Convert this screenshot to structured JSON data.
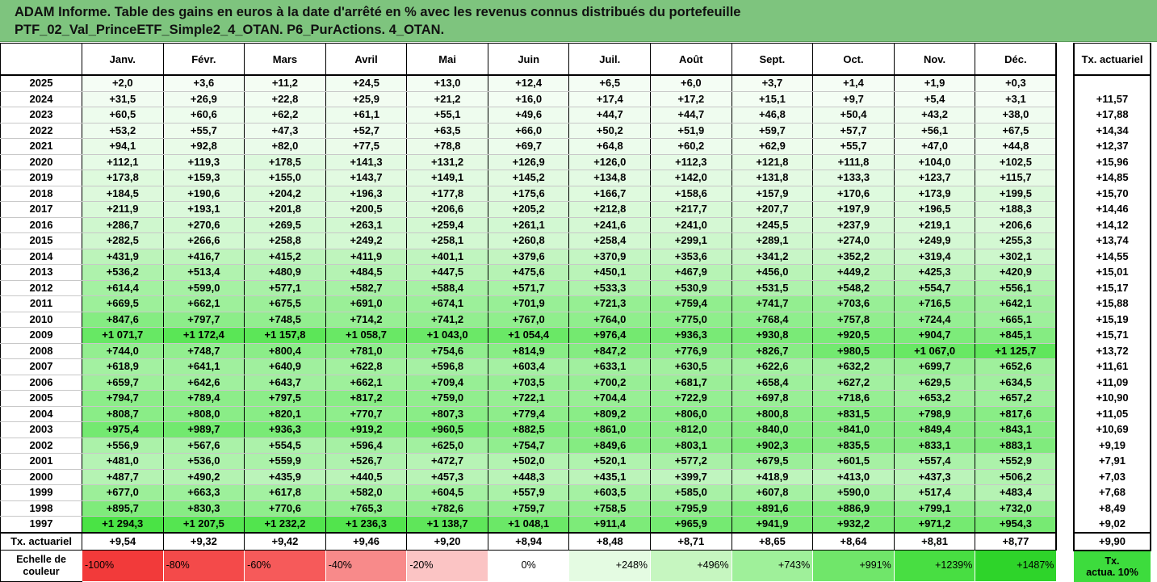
{
  "header": {
    "line1": "ADAM Informe. Table des gains en euros à la date d'arrêté en % avec les revenus connus distribués du portefeuille",
    "line2": "PTF_02_Val_PrinceETF_Simple2_4_OTAN. P6_PurActions. 4_OTAN."
  },
  "months": [
    "Janv.",
    "Févr.",
    "Mars",
    "Avril",
    "Mai",
    "Juin",
    "Juil.",
    "Août",
    "Sept.",
    "Oct.",
    "Nov.",
    "Déc."
  ],
  "side_header": "Tx. actuariel",
  "rows": [
    {
      "year": "2025",
      "values": [
        "+2,0",
        "+3,6",
        "+11,2",
        "+24,5",
        "+13,0",
        "+12,4",
        "+6,5",
        "+6,0",
        "+3,7",
        "+1,4",
        "+1,9",
        "+0,3"
      ],
      "tx": ""
    },
    {
      "year": "2024",
      "values": [
        "+31,5",
        "+26,9",
        "+22,8",
        "+25,9",
        "+21,2",
        "+16,0",
        "+17,4",
        "+17,2",
        "+15,1",
        "+9,7",
        "+5,4",
        "+3,1"
      ],
      "tx": "+11,57"
    },
    {
      "year": "2023",
      "values": [
        "+60,5",
        "+60,6",
        "+62,2",
        "+61,1",
        "+55,1",
        "+49,6",
        "+44,7",
        "+44,7",
        "+46,8",
        "+50,4",
        "+43,2",
        "+38,0"
      ],
      "tx": "+17,88"
    },
    {
      "year": "2022",
      "values": [
        "+53,2",
        "+55,7",
        "+47,3",
        "+52,7",
        "+63,5",
        "+66,0",
        "+50,2",
        "+51,9",
        "+59,7",
        "+57,7",
        "+56,1",
        "+67,5"
      ],
      "tx": "+14,34"
    },
    {
      "year": "2021",
      "values": [
        "+94,1",
        "+92,8",
        "+82,0",
        "+77,5",
        "+78,8",
        "+69,7",
        "+64,8",
        "+60,2",
        "+62,9",
        "+55,7",
        "+47,0",
        "+44,8"
      ],
      "tx": "+12,37"
    },
    {
      "year": "2020",
      "values": [
        "+112,1",
        "+119,3",
        "+178,5",
        "+141,3",
        "+131,2",
        "+126,9",
        "+126,0",
        "+112,3",
        "+121,8",
        "+111,8",
        "+104,0",
        "+102,5"
      ],
      "tx": "+15,96"
    },
    {
      "year": "2019",
      "values": [
        "+173,8",
        "+159,3",
        "+155,0",
        "+143,7",
        "+149,1",
        "+145,2",
        "+134,8",
        "+142,0",
        "+131,8",
        "+133,3",
        "+123,7",
        "+115,7"
      ],
      "tx": "+14,85"
    },
    {
      "year": "2018",
      "values": [
        "+184,5",
        "+190,6",
        "+204,2",
        "+196,3",
        "+177,8",
        "+175,6",
        "+166,7",
        "+158,6",
        "+157,9",
        "+170,6",
        "+173,9",
        "+199,5"
      ],
      "tx": "+15,70"
    },
    {
      "year": "2017",
      "values": [
        "+211,9",
        "+193,1",
        "+201,8",
        "+200,5",
        "+206,6",
        "+205,2",
        "+212,8",
        "+217,7",
        "+207,7",
        "+197,9",
        "+196,5",
        "+188,3"
      ],
      "tx": "+14,46"
    },
    {
      "year": "2016",
      "values": [
        "+286,7",
        "+270,6",
        "+269,5",
        "+263,1",
        "+259,4",
        "+261,1",
        "+241,6",
        "+241,0",
        "+245,5",
        "+237,9",
        "+219,1",
        "+206,6"
      ],
      "tx": "+14,12"
    },
    {
      "year": "2015",
      "values": [
        "+282,5",
        "+266,6",
        "+258,8",
        "+249,2",
        "+258,1",
        "+260,8",
        "+258,4",
        "+299,1",
        "+289,1",
        "+274,0",
        "+249,9",
        "+255,3"
      ],
      "tx": "+13,74"
    },
    {
      "year": "2014",
      "values": [
        "+431,9",
        "+416,7",
        "+415,2",
        "+411,9",
        "+401,1",
        "+379,6",
        "+370,9",
        "+353,6",
        "+341,2",
        "+352,2",
        "+319,4",
        "+302,1"
      ],
      "tx": "+14,55"
    },
    {
      "year": "2013",
      "values": [
        "+536,2",
        "+513,4",
        "+480,9",
        "+484,5",
        "+447,5",
        "+475,6",
        "+450,1",
        "+467,9",
        "+456,0",
        "+449,2",
        "+425,3",
        "+420,9"
      ],
      "tx": "+15,01"
    },
    {
      "year": "2012",
      "values": [
        "+614,4",
        "+599,0",
        "+577,1",
        "+582,7",
        "+588,4",
        "+571,7",
        "+533,3",
        "+530,9",
        "+531,5",
        "+548,2",
        "+554,7",
        "+556,1"
      ],
      "tx": "+15,17"
    },
    {
      "year": "2011",
      "values": [
        "+669,5",
        "+662,1",
        "+675,5",
        "+691,0",
        "+674,1",
        "+701,9",
        "+721,3",
        "+759,4",
        "+741,7",
        "+703,6",
        "+716,5",
        "+642,1"
      ],
      "tx": "+15,88"
    },
    {
      "year": "2010",
      "values": [
        "+847,6",
        "+797,7",
        "+748,5",
        "+714,2",
        "+741,2",
        "+767,0",
        "+764,0",
        "+775,0",
        "+768,4",
        "+757,8",
        "+724,4",
        "+665,1"
      ],
      "tx": "+15,19"
    },
    {
      "year": "2009",
      "values": [
        "+1 071,7",
        "+1 172,4",
        "+1 157,8",
        "+1 058,7",
        "+1 043,0",
        "+1 054,4",
        "+976,4",
        "+936,3",
        "+930,8",
        "+920,5",
        "+904,7",
        "+845,1"
      ],
      "tx": "+15,71"
    },
    {
      "year": "2008",
      "values": [
        "+744,0",
        "+748,7",
        "+800,4",
        "+781,0",
        "+754,6",
        "+814,9",
        "+847,2",
        "+776,9",
        "+826,7",
        "+980,5",
        "+1 067,0",
        "+1 125,7"
      ],
      "tx": "+13,72"
    },
    {
      "year": "2007",
      "values": [
        "+618,9",
        "+641,1",
        "+640,9",
        "+622,8",
        "+596,8",
        "+603,4",
        "+633,1",
        "+630,5",
        "+622,6",
        "+632,2",
        "+699,7",
        "+652,6"
      ],
      "tx": "+11,61"
    },
    {
      "year": "2006",
      "values": [
        "+659,7",
        "+642,6",
        "+643,7",
        "+662,1",
        "+709,4",
        "+703,5",
        "+700,2",
        "+681,7",
        "+658,4",
        "+627,2",
        "+629,5",
        "+634,5"
      ],
      "tx": "+11,09"
    },
    {
      "year": "2005",
      "values": [
        "+794,7",
        "+789,4",
        "+797,5",
        "+817,2",
        "+759,0",
        "+722,1",
        "+704,4",
        "+722,9",
        "+697,8",
        "+718,6",
        "+653,2",
        "+657,2"
      ],
      "tx": "+10,90"
    },
    {
      "year": "2004",
      "values": [
        "+808,7",
        "+808,0",
        "+820,1",
        "+770,7",
        "+807,3",
        "+779,4",
        "+809,2",
        "+806,0",
        "+800,8",
        "+831,5",
        "+798,9",
        "+817,6"
      ],
      "tx": "+11,05"
    },
    {
      "year": "2003",
      "values": [
        "+975,4",
        "+989,7",
        "+936,3",
        "+919,2",
        "+960,5",
        "+882,5",
        "+861,0",
        "+812,0",
        "+840,0",
        "+841,0",
        "+849,4",
        "+843,1"
      ],
      "tx": "+10,69"
    },
    {
      "year": "2002",
      "values": [
        "+556,9",
        "+567,6",
        "+554,5",
        "+596,4",
        "+625,0",
        "+754,7",
        "+849,6",
        "+803,1",
        "+902,3",
        "+835,5",
        "+833,1",
        "+883,1"
      ],
      "tx": "+9,19"
    },
    {
      "year": "2001",
      "values": [
        "+481,0",
        "+536,0",
        "+559,9",
        "+526,7",
        "+472,7",
        "+502,0",
        "+520,1",
        "+577,2",
        "+679,5",
        "+601,5",
        "+557,4",
        "+552,9"
      ],
      "tx": "+7,91"
    },
    {
      "year": "2000",
      "values": [
        "+487,7",
        "+490,2",
        "+435,9",
        "+440,5",
        "+457,3",
        "+448,3",
        "+435,1",
        "+399,7",
        "+418,9",
        "+413,0",
        "+437,3",
        "+506,2"
      ],
      "tx": "+7,03"
    },
    {
      "year": "1999",
      "values": [
        "+677,0",
        "+663,3",
        "+617,8",
        "+582,0",
        "+604,5",
        "+557,9",
        "+603,5",
        "+585,0",
        "+607,8",
        "+590,0",
        "+517,4",
        "+483,4"
      ],
      "tx": "+7,68"
    },
    {
      "year": "1998",
      "values": [
        "+895,7",
        "+830,3",
        "+770,6",
        "+765,3",
        "+782,6",
        "+759,7",
        "+758,5",
        "+795,9",
        "+891,6",
        "+886,9",
        "+799,1",
        "+732,0"
      ],
      "tx": "+8,49"
    },
    {
      "year": "1997",
      "values": [
        "+1 294,3",
        "+1 207,5",
        "+1 232,2",
        "+1 236,3",
        "+1 138,7",
        "+1 048,1",
        "+911,4",
        "+965,9",
        "+941,9",
        "+932,2",
        "+971,2",
        "+954,3"
      ],
      "tx": "+9,02"
    }
  ],
  "tx_row": {
    "label": "Tx. actuariel",
    "values": [
      "+9,54",
      "+9,32",
      "+9,42",
      "+9,46",
      "+9,20",
      "+8,94",
      "+8,48",
      "+8,71",
      "+8,65",
      "+8,64",
      "+8,81",
      "+8,77"
    ],
    "total": "+9,90"
  },
  "scale": {
    "label_line1": "Echelle de",
    "label_line2": "couleur",
    "items": [
      {
        "text": "-100%",
        "bg": "#f23a3a",
        "align": "left"
      },
      {
        "text": "-80%",
        "bg": "#f44a4a",
        "align": "left"
      },
      {
        "text": "-60%",
        "bg": "#f65a5a",
        "align": "left"
      },
      {
        "text": "-40%",
        "bg": "#f88a8a",
        "align": "left"
      },
      {
        "text": "-20%",
        "bg": "#fbc4c4",
        "align": "left"
      },
      {
        "text": "0%",
        "bg": "#ffffff",
        "align": "center"
      },
      {
        "text": "+248%",
        "bg": "#e4fbe2",
        "align": "right"
      },
      {
        "text": "+496%",
        "bg": "#c6f6c0",
        "align": "right"
      },
      {
        "text": "+743%",
        "bg": "#9ff09a",
        "align": "right"
      },
      {
        "text": "+991%",
        "bg": "#70e66a",
        "align": "right"
      },
      {
        "text": "+1239%",
        "bg": "#48de42",
        "align": "right"
      },
      {
        "text": "+1487%",
        "bg": "#2ed42a",
        "align": "right"
      }
    ],
    "side_line1": "Tx.",
    "side_line2": "actua. 10%"
  }
}
